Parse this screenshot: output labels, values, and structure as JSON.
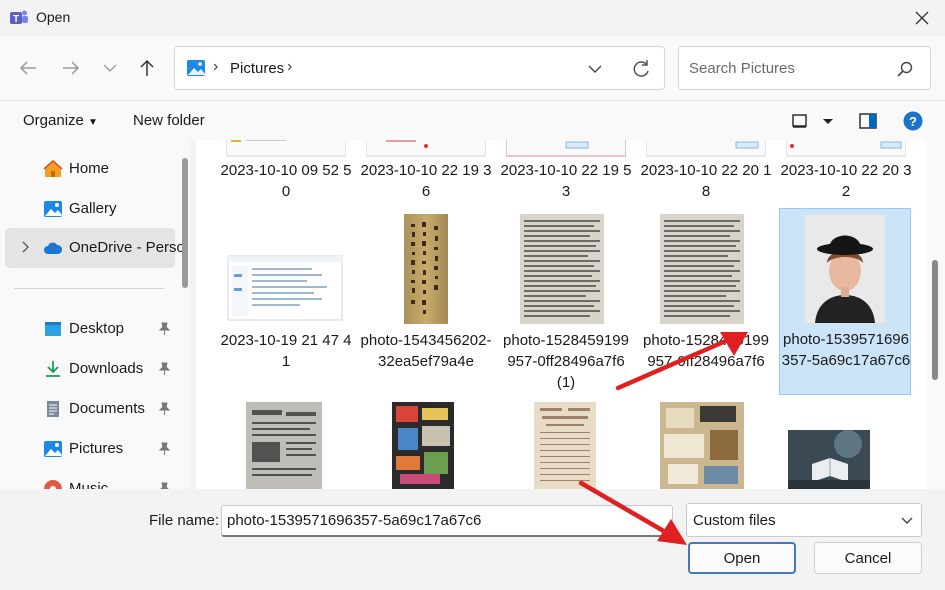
{
  "window": {
    "title": "Open"
  },
  "address": {
    "location": "Pictures"
  },
  "search": {
    "placeholder": "Search Pictures"
  },
  "toolbar": {
    "organize": "Organize",
    "new_folder": "New folder"
  },
  "sidebar": {
    "items": [
      {
        "label": "Home",
        "icon": "home-icon"
      },
      {
        "label": "Gallery",
        "icon": "gallery-icon"
      },
      {
        "label": "OneDrive - Perso",
        "icon": "cloud-icon",
        "selected": true
      },
      {
        "label": "Desktop",
        "icon": "desktop-icon",
        "pinned": true
      },
      {
        "label": "Downloads",
        "icon": "download-icon",
        "pinned": true
      },
      {
        "label": "Documents",
        "icon": "document-icon",
        "pinned": true
      },
      {
        "label": "Pictures",
        "icon": "pictures-icon",
        "pinned": true
      },
      {
        "label": "Music",
        "icon": "music-icon",
        "pinned": true
      }
    ]
  },
  "files": {
    "row1": [
      {
        "name": "2023-10-10 09 52 50"
      },
      {
        "name": "2023-10-10 22 19 36"
      },
      {
        "name": "2023-10-10 22 19 53"
      },
      {
        "name": "2023-10-10 22 20 18"
      },
      {
        "name": "2023-10-10 22 20 32"
      }
    ],
    "row2": [
      {
        "name": "2023-10-19 21 47 41"
      },
      {
        "name": "photo-1543456202-32ea5ef79a4e"
      },
      {
        "name": "photo-1528459199957-0ff28496a7f6 (1)"
      },
      {
        "name": "photo-1528459199957-0ff28496a7f6"
      },
      {
        "name": "photo-1539571696357-5a69c17a67c6",
        "selected": true
      }
    ]
  },
  "footer": {
    "file_name_label": "File name:",
    "file_name_value": "photo-1539571696357-5a69c17a67c6",
    "filter_value": "Custom files",
    "open_label": "Open",
    "cancel_label": "Cancel"
  },
  "colors": {
    "accent": "#0067c0",
    "selection": "#cce4f7",
    "annotation_arrow": "#e02020"
  }
}
